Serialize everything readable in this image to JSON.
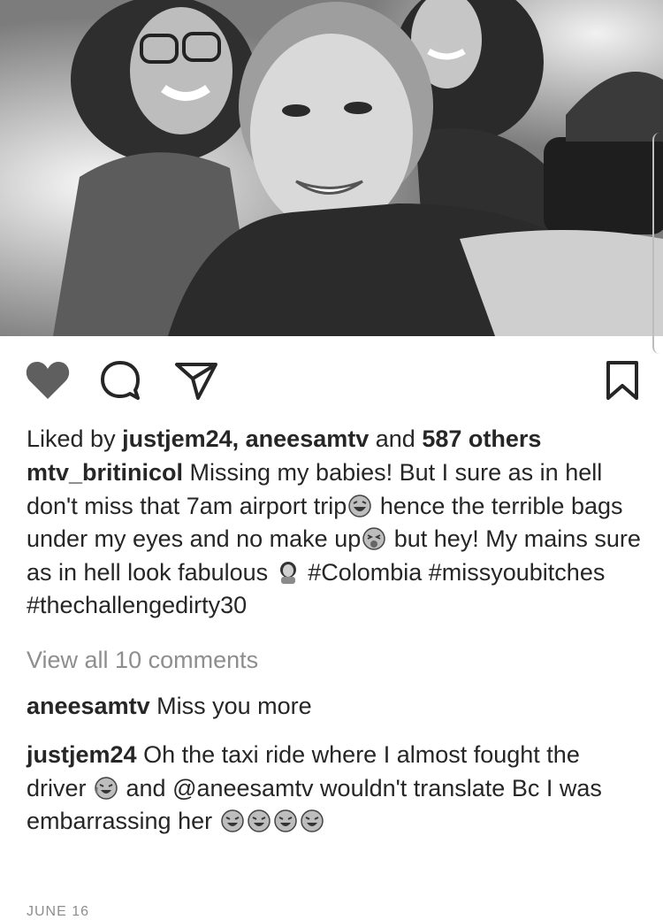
{
  "post": {
    "photo_alt": "Selfie of three women"
  },
  "actions": {
    "like_icon": "heart-icon",
    "comment_icon": "comment-bubble-icon",
    "share_icon": "paper-plane-icon",
    "save_icon": "bookmark-icon"
  },
  "likes": {
    "prefix": "Liked by ",
    "user1": "justjem24",
    "sep": ", ",
    "user2": "aneesamtv",
    "and": " and ",
    "others": "587 others"
  },
  "caption": {
    "username": "mtv_britinicol",
    "text1": " Missing my babies! But I sure as in hell don't miss that 7am airport trip",
    "text2": " hence the terrible bags under my eyes and no make up",
    "text3": " but hey! My mains sure as in hell look fabulous ",
    "text4": " #Colombia #missyoubitches #thechallengedirty30"
  },
  "view_all": "View all 10 comments",
  "comments": [
    {
      "username": "aneesamtv",
      "text": " Miss you more"
    },
    {
      "username": "justjem24",
      "text1": " Oh the taxi ride where I almost fought the driver ",
      "text2": " and @aneesamtv wouldn't translate Bc I was embarrassing her "
    }
  ],
  "date": "JUNE 16"
}
